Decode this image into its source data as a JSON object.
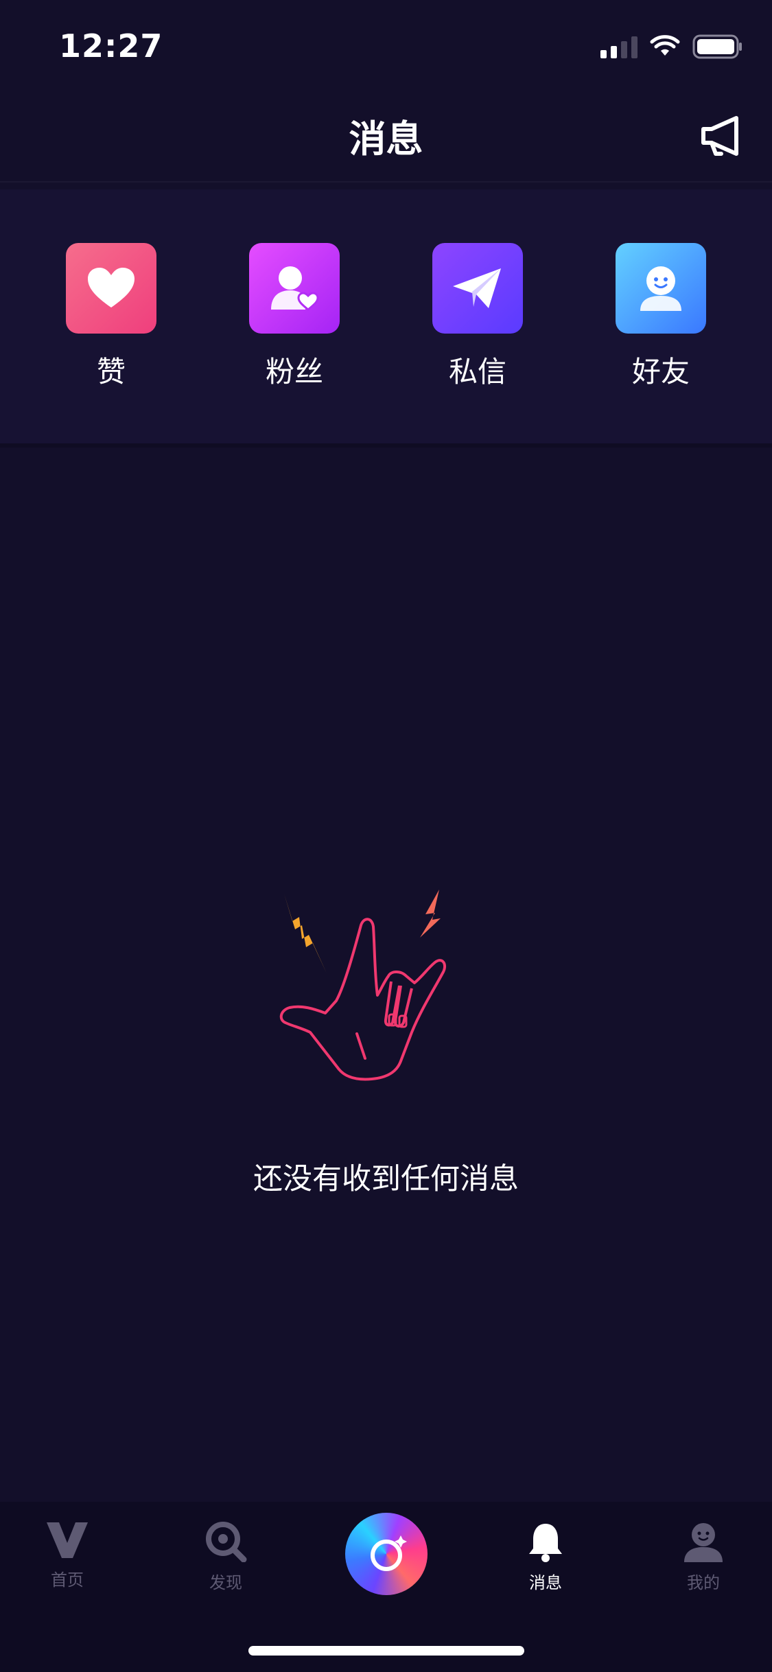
{
  "status_bar": {
    "time": "12:27"
  },
  "header": {
    "title": "消息",
    "announce_icon": "megaphone-icon"
  },
  "shortcuts": [
    {
      "label": "赞",
      "icon": "heart-icon",
      "color_from": "#f0407e",
      "color_to": "#f66d8c"
    },
    {
      "label": "粉丝",
      "icon": "fan-user-heart-icon",
      "color_from": "#b534ff",
      "color_to": "#e54dff"
    },
    {
      "label": "私信",
      "icon": "paper-plane-icon",
      "color_from": "#5e3bff",
      "color_to": "#8d45ff"
    },
    {
      "label": "好友",
      "icon": "friend-face-icon",
      "color_from": "#3c7dff",
      "color_to": "#5cc8ff"
    }
  ],
  "empty_state": {
    "text": "还没有收到任何消息",
    "illustration": "rock-hand-icon"
  },
  "tab_bar": {
    "tabs": [
      {
        "label": "首页",
        "icon": "v-logo-icon"
      },
      {
        "label": "发现",
        "icon": "search-icon"
      },
      {
        "label": "",
        "icon": "camera-capture-icon"
      },
      {
        "label": "消息",
        "icon": "bell-icon",
        "active": true
      },
      {
        "label": "我的",
        "icon": "profile-icon"
      }
    ]
  }
}
